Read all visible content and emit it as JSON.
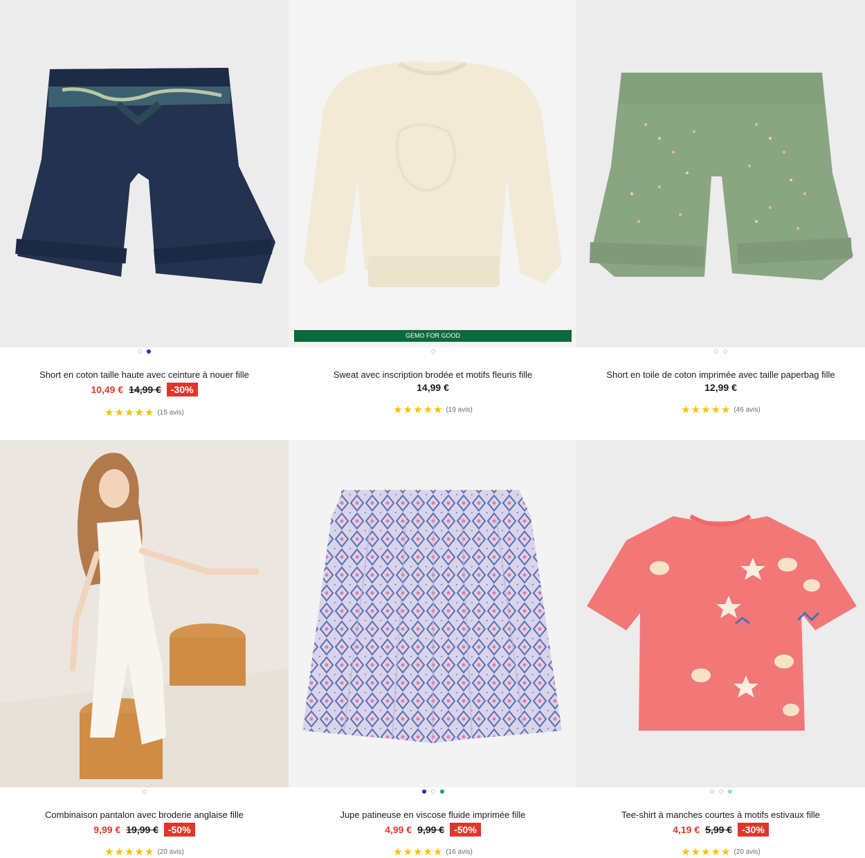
{
  "products": [
    {
      "title": "Short en coton taille haute avec ceinture à nouer fille",
      "price": "10,49 €",
      "old_price": "14,99 €",
      "discount": "-30%",
      "rating_stars": "★★★★★",
      "reviews": "(15 avis)",
      "swatches": [
        "#ffffff",
        "#1c2fb8"
      ]
    },
    {
      "title": "Sweat avec inscription brodée et motifs fleuris fille",
      "price": "14,99 €",
      "rating_stars": "★★★★★",
      "reviews": "(19 avis)",
      "label": "GEMO FOR GOOD",
      "swatches": [
        "#ffffff"
      ]
    },
    {
      "title": "Short en toile de coton imprimée avec taille paperbag fille",
      "price": "12,99 €",
      "rating_stars": "★★★★★",
      "reviews": "(46 avis)",
      "swatches": [
        "#ffffff",
        "#ffffff"
      ]
    },
    {
      "title": "Combinaison pantalon avec broderie anglaise fille",
      "price": "9,99 €",
      "old_price": "19,99 €",
      "discount": "-50%",
      "rating_stars": "★★★★★",
      "reviews": "(20 avis)",
      "swatches": [
        "#ffffff"
      ]
    },
    {
      "title": "Jupe patineuse en viscose fluide imprimée fille",
      "price": "4,99 €",
      "old_price": "9,99 €",
      "discount": "-50%",
      "rating_stars": "★★★★★",
      "reviews": "(16 avis)",
      "swatches": [
        "#1c2fb8",
        "#ffffff",
        "#1e9a5a"
      ]
    },
    {
      "title": "Tee-shirt à manches courtes à motifs estivaux fille",
      "price": "4,19 €",
      "old_price": "5,99 €",
      "discount": "-30%",
      "rating_stars": "★★★★★",
      "reviews": "(20 avis)",
      "swatches": [
        "#fff4d6",
        "#ffffff",
        "#8fe3b0"
      ]
    }
  ],
  "colors": {
    "sale": "#e0362b",
    "star": "#f2c200",
    "gemo_green": "#0b6a3a"
  }
}
